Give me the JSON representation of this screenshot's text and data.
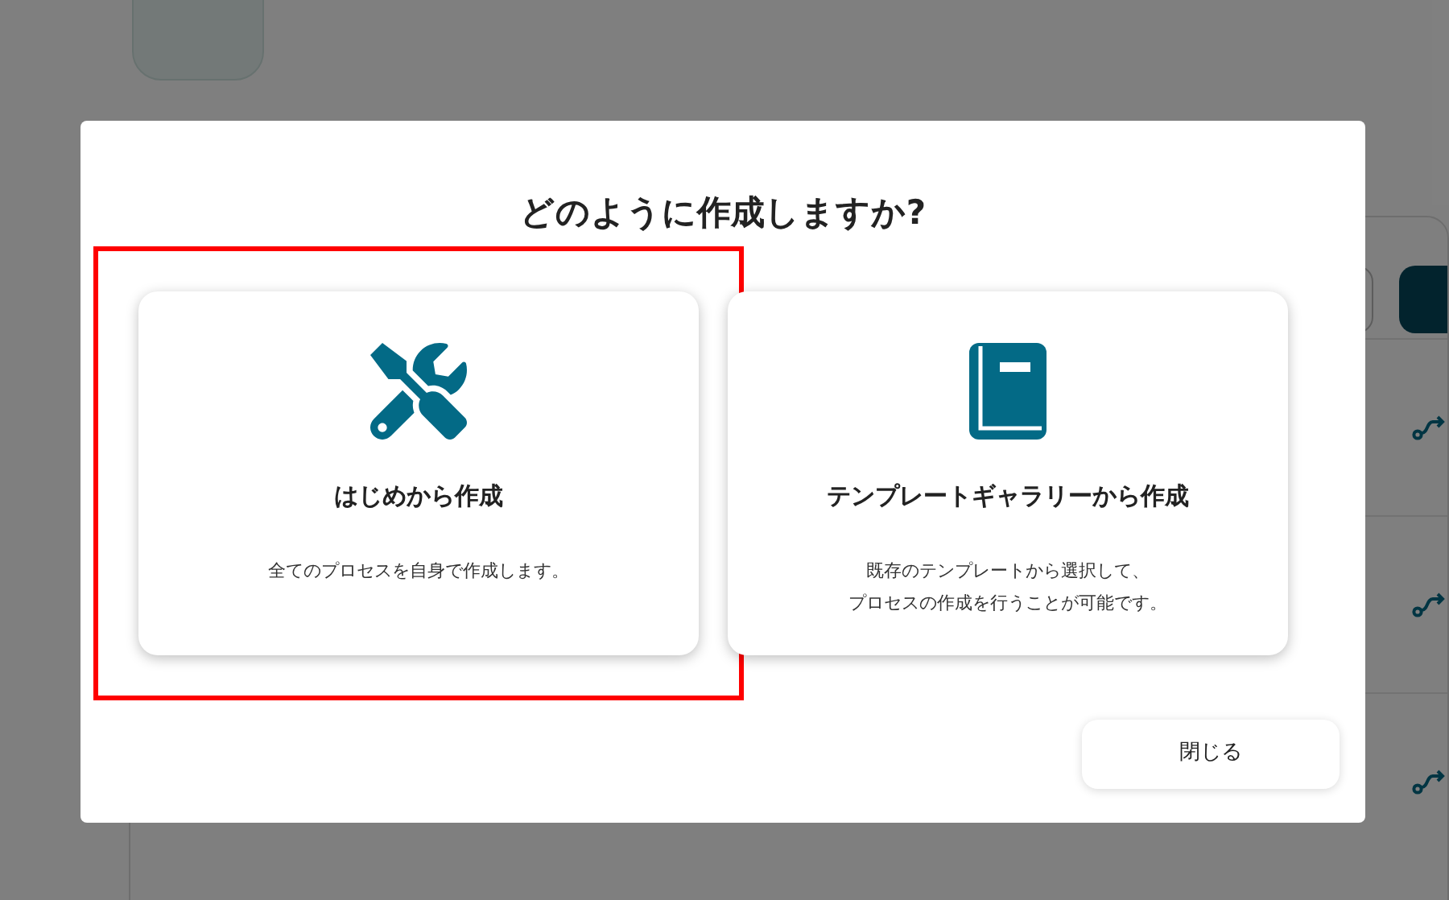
{
  "background": {
    "rows": [
      {
        "kind": "flow"
      },
      {
        "kind": "flow"
      },
      {
        "kind": "flow"
      }
    ]
  },
  "dialog": {
    "title": "どのように作成しますか?",
    "options": [
      {
        "kind": "tools",
        "title": "はじめから作成",
        "description": [
          "全てのプロセスを自身で作成します。"
        ],
        "highlighted": true
      },
      {
        "kind": "book",
        "title": "テンプレートギャラリーから作成",
        "description": [
          "既存のテンプレートから選択して、",
          "プロセスの作成を行うことが可能です。"
        ],
        "highlighted": false
      }
    ],
    "close": "閉じる"
  }
}
